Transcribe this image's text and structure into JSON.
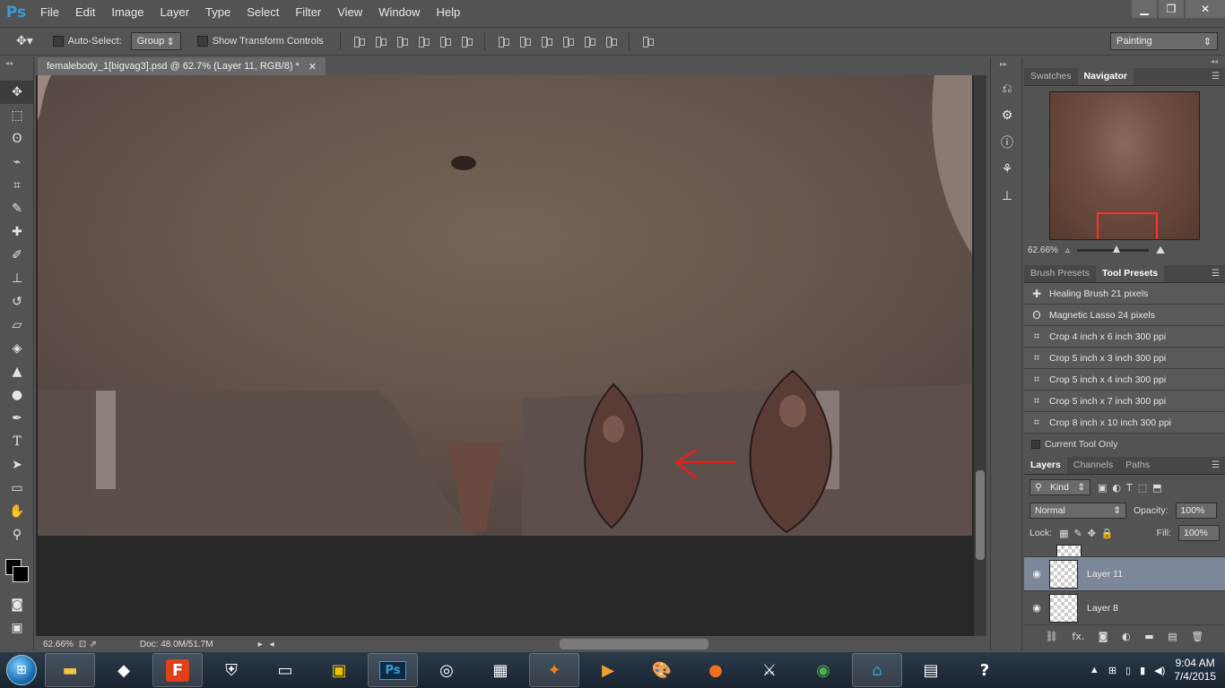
{
  "app": {
    "logo": "Ps"
  },
  "menu": [
    "File",
    "Edit",
    "Image",
    "Layer",
    "Type",
    "Select",
    "Filter",
    "View",
    "Window",
    "Help"
  ],
  "window_controls": {
    "minimize": "▁",
    "restore": "❐",
    "close": "✕"
  },
  "options": {
    "auto_select_label": "Auto-Select:",
    "auto_select_value": "Group",
    "transform_label": "Show Transform Controls",
    "workspace": "Painting"
  },
  "document": {
    "tab_title": "femalebody_1[bigvag3].psd @ 62.7% (Layer 11, RGB/8) *",
    "tab_close": "✕"
  },
  "status": {
    "zoom": "62.66%",
    "doc_size": "Doc: 48.0M/51.7M"
  },
  "navigator": {
    "tabs": [
      "Swatches",
      "Navigator"
    ],
    "active_tab": "Navigator",
    "zoom": "62.66%"
  },
  "presets": {
    "tabs": [
      "Brush Presets",
      "Tool Presets"
    ],
    "active_tab": "Tool Presets",
    "items": [
      "Healing Brush 21 pixels",
      "Magnetic Lasso 24 pixels",
      "Crop 4 inch x 6 inch 300 ppi",
      "Crop 5 inch x 3 inch 300 ppi",
      "Crop 5 inch x 4 inch 300 ppi",
      "Crop 5 inch x 7 inch 300 ppi",
      "Crop 8 inch x 10 inch 300 ppi"
    ],
    "current_tool_only": "Current Tool Only"
  },
  "layers": {
    "tabs": [
      "Layers",
      "Channels",
      "Paths"
    ],
    "active_tab": "Layers",
    "filter_kind": "Kind",
    "blend_mode": "Normal",
    "opacity_label": "Opacity:",
    "opacity": "100%",
    "lock_label": "Lock:",
    "fill_label": "Fill:",
    "fill": "100%",
    "items": [
      {
        "name": "Layer 11",
        "selected": true
      },
      {
        "name": "Layer 8",
        "selected": false
      }
    ],
    "fx_label": "fx."
  },
  "taskbar": {
    "time": "9:04 AM",
    "date": "7/4/2015",
    "apps": [
      "F",
      "Ps"
    ]
  }
}
